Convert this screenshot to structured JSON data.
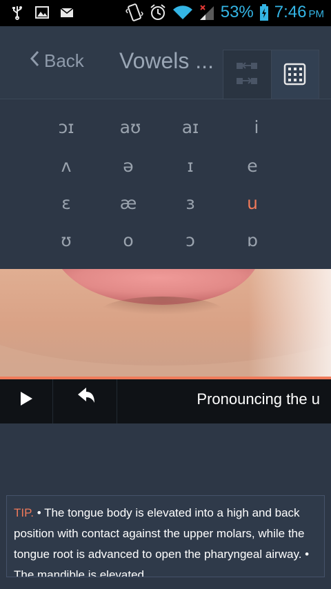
{
  "status_bar": {
    "icons": [
      "usb-icon",
      "image-icon",
      "mail-icon",
      "vibrate-icon",
      "alarm-icon",
      "wifi-icon",
      "signal-icon"
    ],
    "battery_percent": "53%",
    "time": "7:46",
    "ampm": "PM",
    "accent_color": "#34b5e5"
  },
  "header": {
    "back_label": "Back",
    "title": "Vowels ...",
    "toolbar_icons": [
      "arrows-swap-icon",
      "keypad-grid-icon"
    ]
  },
  "symbols": {
    "rows": [
      [
        "ɔɪ",
        "aʊ",
        "aɪ",
        "i"
      ],
      [
        "ʌ",
        "ə",
        "ɪ",
        "e"
      ],
      [
        "ɛ",
        "æ",
        "ɜ",
        "u"
      ],
      [
        "ʊ",
        "o",
        "ɔ",
        "ɒ"
      ]
    ],
    "selected": "u",
    "selected_color": "#f07a5a"
  },
  "player": {
    "caption": "Pronouncing the u",
    "icons": [
      "play-icon",
      "replay-icon"
    ],
    "progress": 1.0
  },
  "tip": {
    "label": "TIP.",
    "text": "• The tongue body is elevated into a high and back position with contact against the upper molars, while the tongue root is advanced to open the pharyngeal airway. • The mandible is elevated."
  }
}
